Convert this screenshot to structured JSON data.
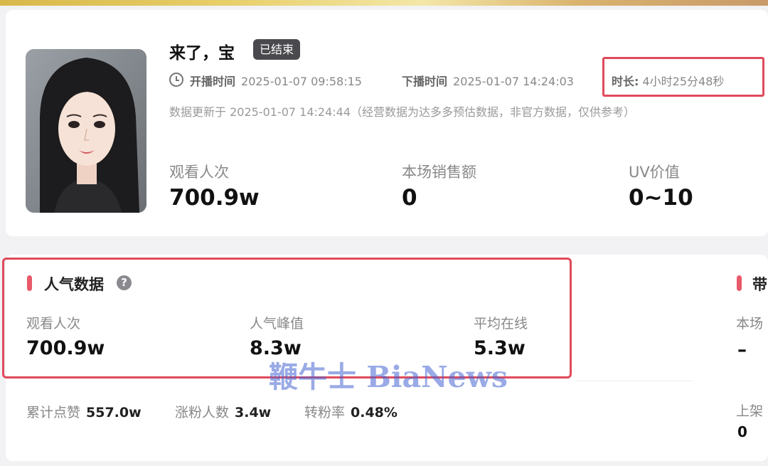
{
  "header": {
    "title": "来了，宝",
    "status_badge": "已结束",
    "start_label": "开播时间",
    "start_time": "2025-01-07 09:58:15",
    "end_label": "下播时间",
    "end_time": "2025-01-07 14:24:03",
    "duration_label": "时长:",
    "duration_value": "4小时25分48秒",
    "update_note": "数据更新于 2025-01-07 14:24:44（经营数据为达多多预估数据，非官方数据，仅供参考）"
  },
  "overview": [
    {
      "label": "观看人次",
      "value": "700.9w"
    },
    {
      "label": "本场销售额",
      "value": "0"
    },
    {
      "label": "UV价值",
      "value": "0~10"
    }
  ],
  "popularity": {
    "title": "人气数据",
    "help_icon": "question-circle-icon",
    "metrics": [
      {
        "label": "观看人次",
        "value": "700.9w"
      },
      {
        "label": "人气峰值",
        "value": "8.3w"
      },
      {
        "label": "平均在线",
        "value": "5.3w"
      }
    ],
    "secondary": [
      {
        "label": "累计点赞",
        "value": "557.0w"
      },
      {
        "label": "涨粉人数",
        "value": "3.4w"
      },
      {
        "label": "转粉率",
        "value": "0.48%"
      }
    ]
  },
  "right_panel": {
    "title": "带",
    "label1": "本场",
    "value1": "–",
    "label2": "上架",
    "value2": "0"
  },
  "watermark": "鞭牛士 BiaNews",
  "colors": {
    "accent_red": "#e04a5c",
    "section_marker": "#e85a6a",
    "badge_bg": "#4a4a4e"
  }
}
